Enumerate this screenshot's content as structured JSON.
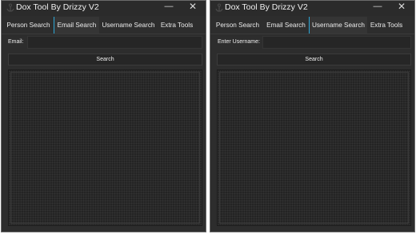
{
  "left_window": {
    "title": "Dox Tool By Drizzy V2",
    "controls": {
      "minimize": "—",
      "close": "✕"
    },
    "tabs": [
      {
        "label": "Person Search"
      },
      {
        "label": "Email Search",
        "active": true
      },
      {
        "label": "Username Search"
      },
      {
        "label": "Extra Tools"
      }
    ],
    "input_label": "Email:",
    "input_value": "",
    "search_label": "Search",
    "output_text": ""
  },
  "right_window": {
    "title": "Dox Tool By Drizzy V2",
    "controls": {
      "minimize": "—",
      "close": "✕"
    },
    "tabs": [
      {
        "label": "Person Search"
      },
      {
        "label": "Email Search"
      },
      {
        "label": "Username Search",
        "active": true
      },
      {
        "label": "Extra Tools"
      }
    ],
    "input_label": "Enter Username:",
    "input_value": "",
    "search_label": "Search",
    "output_text": ""
  },
  "colors": {
    "background": "#2d2d2d",
    "accent": "#2ba6d6",
    "text": "#e6e6e6"
  },
  "icons": {
    "app": "anchor-icon",
    "minimize": "minimize-icon",
    "close": "close-icon"
  }
}
